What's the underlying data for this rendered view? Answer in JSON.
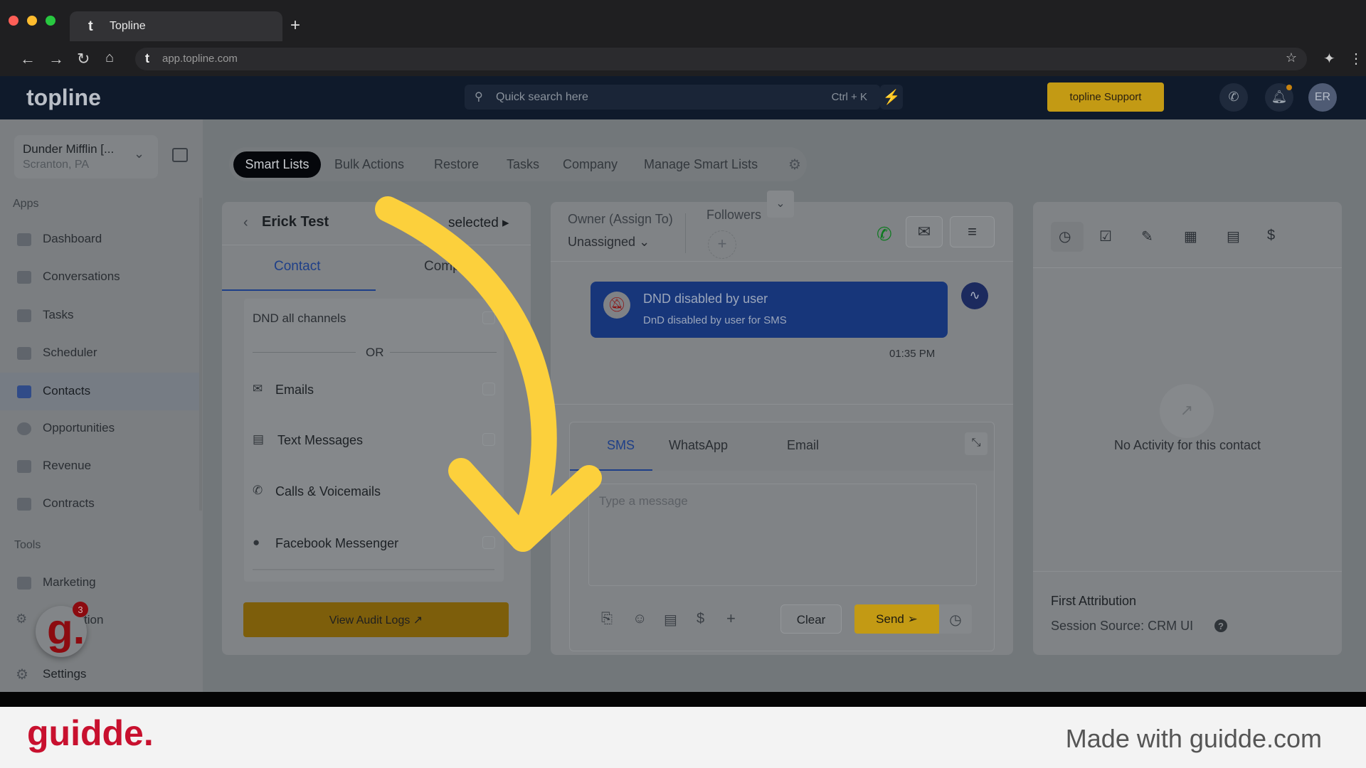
{
  "browser": {
    "tab_title": "Topline",
    "new_tab": "+",
    "url": "app.topline.com"
  },
  "header": {
    "logo": "topline",
    "search_placeholder": "Quick search here",
    "search_shortcut": "Ctrl + K",
    "support_button": "topline Support",
    "avatar_initials": "ER"
  },
  "sidebar": {
    "account_name": "Dunder Mifflin [...",
    "account_location": "Scranton, PA",
    "apps_label": "Apps",
    "items": [
      {
        "label": "Dashboard",
        "icon": "dashboard-icon"
      },
      {
        "label": "Conversations",
        "icon": "chat-icon"
      },
      {
        "label": "Tasks",
        "icon": "tasks-icon"
      },
      {
        "label": "Scheduler",
        "icon": "calendar-icon"
      },
      {
        "label": "Contacts",
        "icon": "user-icon",
        "active": true
      },
      {
        "label": "Opportunities",
        "icon": "target-icon"
      },
      {
        "label": "Revenue",
        "icon": "card-icon"
      },
      {
        "label": "Contracts",
        "icon": "document-icon"
      }
    ],
    "tools_label": "Tools",
    "tools": [
      {
        "label": "Marketing"
      },
      {
        "label": "tion"
      }
    ],
    "settings": "Settings",
    "guidde_badge": "3"
  },
  "top_tabs": [
    "Smart Lists",
    "Bulk Actions",
    "Restore",
    "Tasks",
    "Company",
    "Manage Smart Lists"
  ],
  "contact_panel": {
    "name": "Erick Test",
    "selected_text": "selected",
    "tabs": [
      "Contact",
      "Comp"
    ],
    "dnd_all": "DND all channels",
    "or": "OR",
    "channels": [
      "Emails",
      "Text Messages",
      "Calls & Voicemails",
      "Facebook Messenger"
    ],
    "audit_button": "View Audit Logs"
  },
  "conversation": {
    "owner_label": "Owner (Assign To)",
    "owner_value": "Unassigned",
    "followers_label": "Followers",
    "dnd_title": "DND disabled by user",
    "dnd_sub": "DnD disabled by user for SMS",
    "time": "01:35 PM",
    "compose_tabs": [
      "SMS",
      "WhatsApp",
      "Email"
    ],
    "message_placeholder": "Type a message",
    "clear": "Clear",
    "send": "Send"
  },
  "activity": {
    "empty": "No Activity for this contact",
    "attribution_title": "First Attribution",
    "session_source": "Session Source: CRM UI"
  },
  "footer": {
    "logo": "guidde.",
    "credit": "Made with guidde.com"
  },
  "colors": {
    "accent_yellow": "#fcd03c",
    "dnd_card": "#17367a",
    "support_btn": "#c39a14"
  }
}
